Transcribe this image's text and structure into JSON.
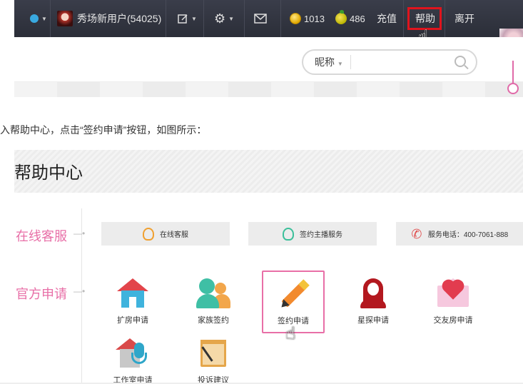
{
  "topbar": {
    "user_name": "秀场新用户(54025)",
    "coins": "1013",
    "fruits": "486",
    "recharge_label": "充值",
    "help_label": "帮助",
    "leave_label": "离开"
  },
  "search": {
    "select_label": "昵称",
    "placeholder": ""
  },
  "instruction": "入帮助中心，点击“签约申请”按钮，如图所示：",
  "help_center": {
    "title": "帮助中心",
    "online_section": "在线客服",
    "apply_section": "官方申请",
    "online_buttons": [
      "在线客服",
      "签约主播服务",
      "服务电话：400-7061-888"
    ],
    "apps": [
      "扩房申请",
      "家族签约",
      "签约申请",
      "星探申请",
      "交友房申请",
      "工作室申请",
      "投诉建议"
    ]
  },
  "colors": {
    "accent_pink": "#e86fa7",
    "help_highlight": "#e0141d",
    "topbar_bg": "#2b2e38"
  },
  "icons": [
    "verified-icon",
    "avatar",
    "edit-icon",
    "gear-icon",
    "mail-icon",
    "coin-icon",
    "fruit-icon",
    "hand-cursor-icon",
    "search-icon",
    "headset-icon",
    "phone-icon",
    "house-icon",
    "family-icon",
    "pencil-icon",
    "scout-icon",
    "heart-envelope-icon",
    "studio-icon",
    "board-icon"
  ]
}
